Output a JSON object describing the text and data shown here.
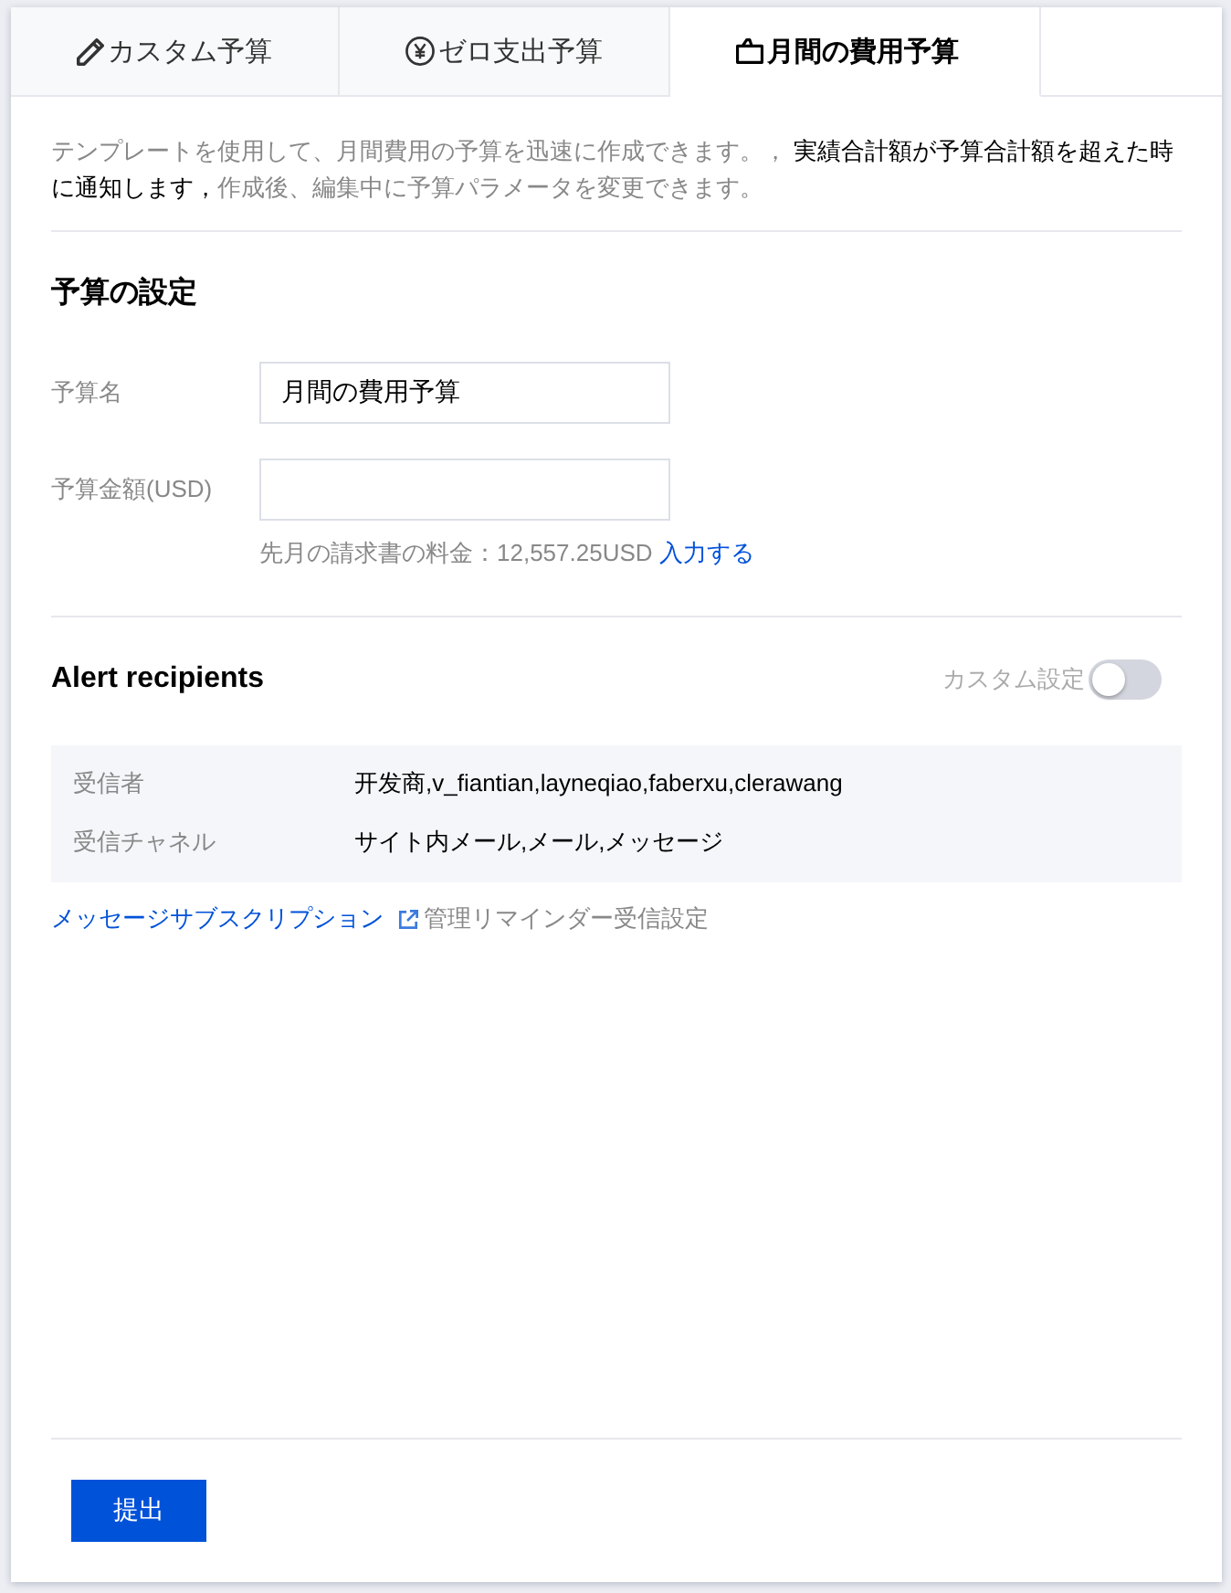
{
  "tabs": [
    {
      "label": "カスタム予算",
      "selected": false
    },
    {
      "label": "ゼロ支出予算",
      "selected": false
    },
    {
      "label": "月間の費用予算",
      "selected": true
    }
  ],
  "description": "テンプレートを使用して、月間費用の予算を迅速に作成できます。， **実績合計額が予算合計額を超えた時に通知します，**作成後、編集中に予算パラメータを変更できます。",
  "budget_settings": {
    "title": "予算の設定",
    "fields": [
      {
        "label": "予算名",
        "value": "月間の費用予算"
      },
      {
        "label": "予算金額(USD)"
      }
    ],
    "hint": {
      "text": "先月の請求書の料金：12,557.25USD",
      "link": "入力する"
    }
  },
  "alert_recipients": {
    "title": "Alert recipients",
    "custom_toggle": {
      "label": "カスタム設定",
      "on": false
    },
    "rows": [
      {
        "label": "受信者",
        "value": "开发商,v_fiantian,layneqiao,faberxu,clerawang"
      },
      {
        "label": "受信チャネル",
        "value": "サイト内メール,メール,メッセージ"
      }
    ]
  },
  "links": {
    "subscription": "メッセージサブスクリプション",
    "manage": "管理リマインダー受信設定"
  },
  "submit_button": "提出"
}
